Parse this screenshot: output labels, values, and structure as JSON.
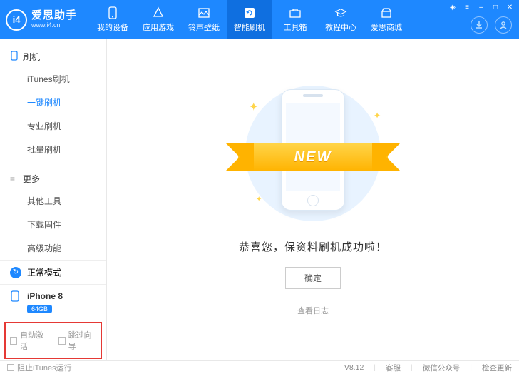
{
  "brand": {
    "logo_text": "i4",
    "name": "爱思助手",
    "url": "www.i4.cn"
  },
  "tabs": [
    {
      "label": "我的设备"
    },
    {
      "label": "应用游戏"
    },
    {
      "label": "铃声壁纸"
    },
    {
      "label": "智能刷机"
    },
    {
      "label": "工具箱"
    },
    {
      "label": "教程中心"
    },
    {
      "label": "爱思商城"
    }
  ],
  "sidebar": {
    "section1": {
      "title": "刷机",
      "items": [
        "iTunes刷机",
        "一键刷机",
        "专业刷机",
        "批量刷机"
      ]
    },
    "section2": {
      "title": "更多",
      "items": [
        "其他工具",
        "下载固件",
        "高级功能"
      ]
    },
    "mode": "正常模式",
    "device": "iPhone 8",
    "storage": "64GB",
    "opt1": "自动激活",
    "opt2": "跳过向导"
  },
  "content": {
    "ribbon": "NEW",
    "message": "恭喜您，保资料刷机成功啦！",
    "ok": "确定",
    "log": "查看日志"
  },
  "status": {
    "block_itunes": "阻止iTunes运行",
    "version": "V8.12",
    "support": "客服",
    "wechat": "微信公众号",
    "update": "检查更新"
  }
}
